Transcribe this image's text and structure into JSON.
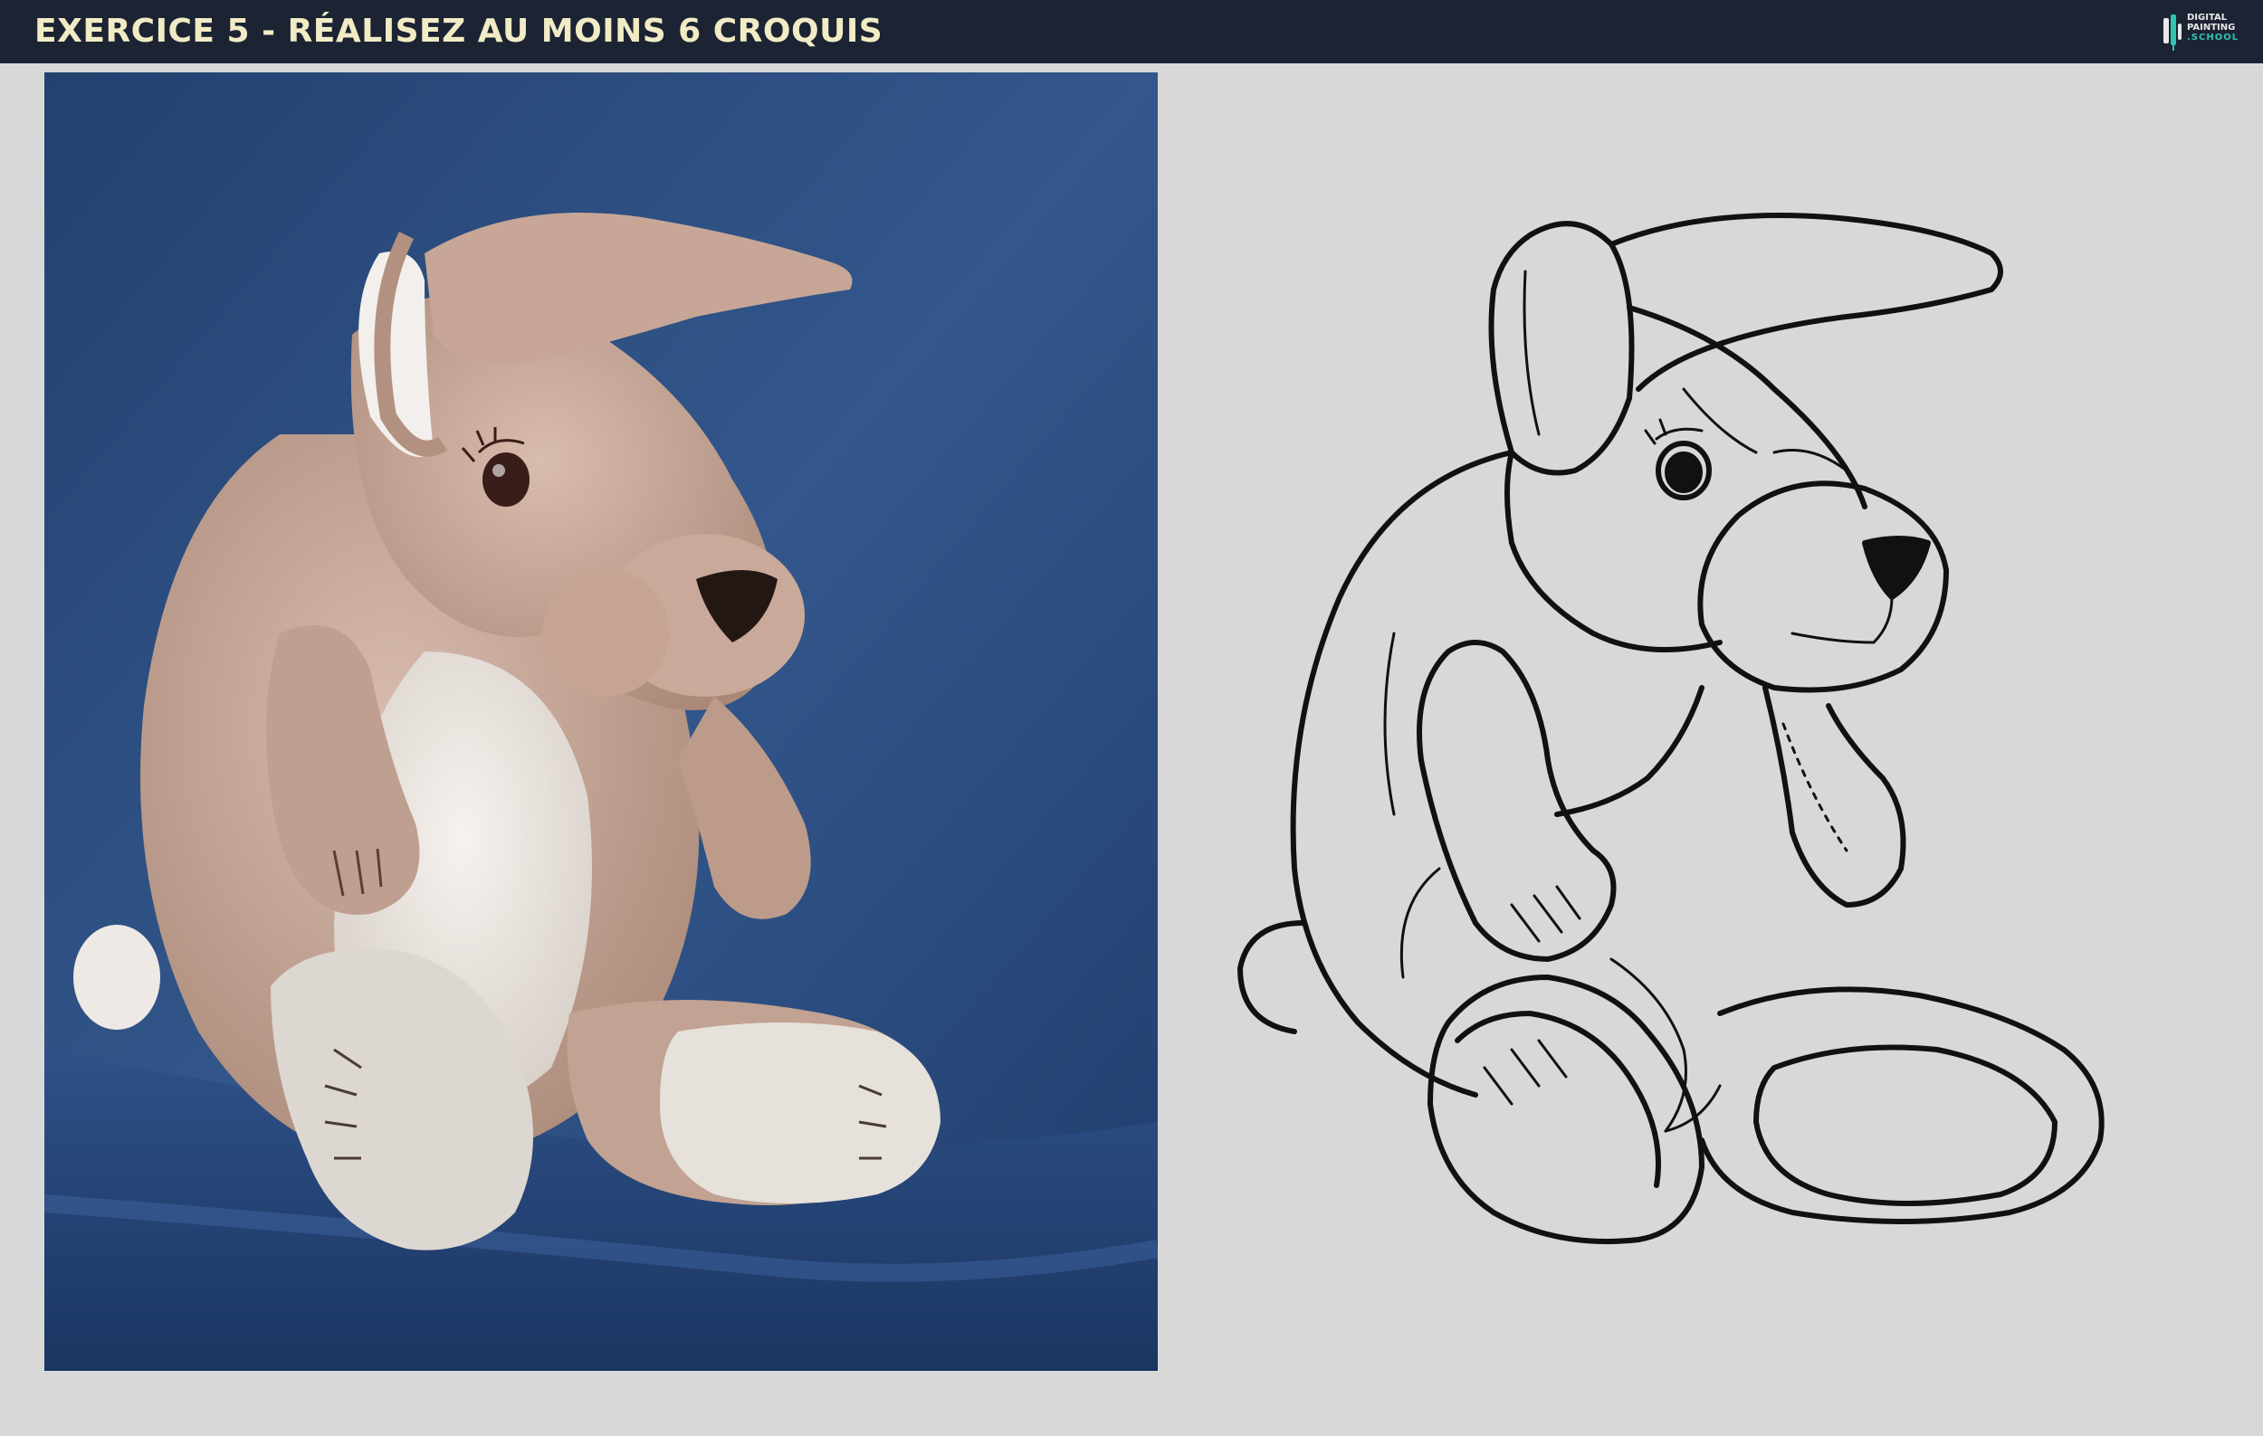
{
  "header": {
    "title": "EXERCICE 5 - RÉALISEZ AU MOINS 6 CROQUIS",
    "logo": {
      "line1": "DIGITAL",
      "line2": "PAINTING",
      "line3": ".SCHOOL",
      "icon": "brush-logo-icon"
    }
  },
  "colors": {
    "header_bg": "#1c2333",
    "title": "#f1ecc5",
    "page_bg": "#d8d8d8",
    "photo_bg": "#2d4b7c",
    "plush": "#c4a596",
    "plush_light": "#ece6e0",
    "logo_accent": "#2fc4b0"
  }
}
